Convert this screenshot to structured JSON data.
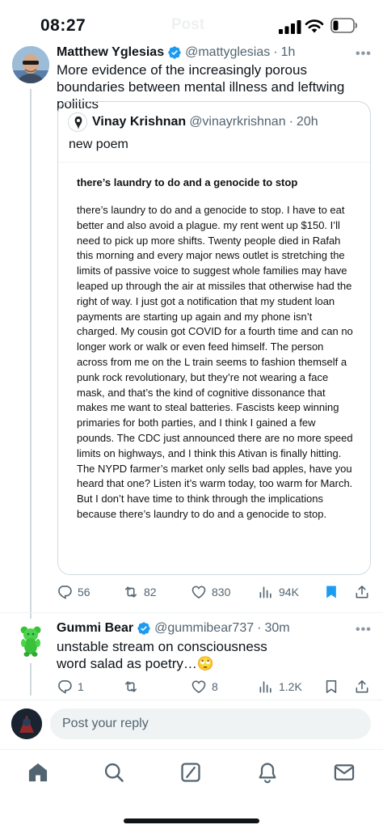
{
  "status_bar": {
    "time": "08:27",
    "faded_header": "Post"
  },
  "tweet": {
    "author_name": "Matthew Yglesias",
    "author_handle": "@mattyglesias",
    "age": "1h",
    "text": "More evidence of the increasingly porous boundaries between mental illness and leftwing politics",
    "quote": {
      "author_name": "Vinay Krishnan",
      "author_handle": "@vinayrkrishnan",
      "age": "20h",
      "text": "new poem",
      "image": {
        "title": "there’s laundry to do and a genocide to stop",
        "body": "there’s laundry to do and a genocide to stop. I have to eat better and also avoid a plague. my rent went up $150. I’ll need to pick up more shifts. Twenty people died in Rafah this morning and every major news outlet is stretching the limits of passive voice to suggest whole families may have leaped up through the air at missiles that otherwise had the right of way. I just got a notification that my student loan payments are starting up again and my phone isn’t charged. My cousin got COVID for a fourth time and can no longer work or walk or even feed himself. The person across from me on the L train seems to fashion themself a punk rock revolutionary, but they’re not wearing a face mask, and that’s the kind of cognitive dissonance that makes me want to steal batteries. Fascists keep winning primaries for both parties, and I think I gained a few pounds. The CDC just announced there are no more speed limits on highways, and I think this Ativan is finally hitting. The NYPD farmer’s market only sells bad apples, have you heard that one? Listen it’s warm today, too warm for March. But I don’t have time to think through the implications because there’s laundry to do and a genocide to stop."
      }
    },
    "stats": {
      "replies": "56",
      "reposts": "82",
      "likes": "830",
      "views": "94K"
    }
  },
  "reply": {
    "author_name": "Gummi Bear",
    "author_handle": "@gummibear737",
    "age": "30m",
    "text": "unstable stream on consciousness word salad as poetry…🙄",
    "stats": {
      "replies": "1",
      "reposts": "",
      "likes": "8",
      "views": "1.2K"
    }
  },
  "composer": {
    "placeholder": "Post your reply"
  },
  "separator": "·",
  "more_label": "•••",
  "colors": {
    "verified": "#1d9bf0",
    "bookmark_active": "#1d9bf0",
    "muted": "#536471",
    "border": "#cfd9de"
  },
  "tabs": [
    "home-icon",
    "search-icon",
    "grok-icon",
    "notifications-icon",
    "messages-icon"
  ]
}
